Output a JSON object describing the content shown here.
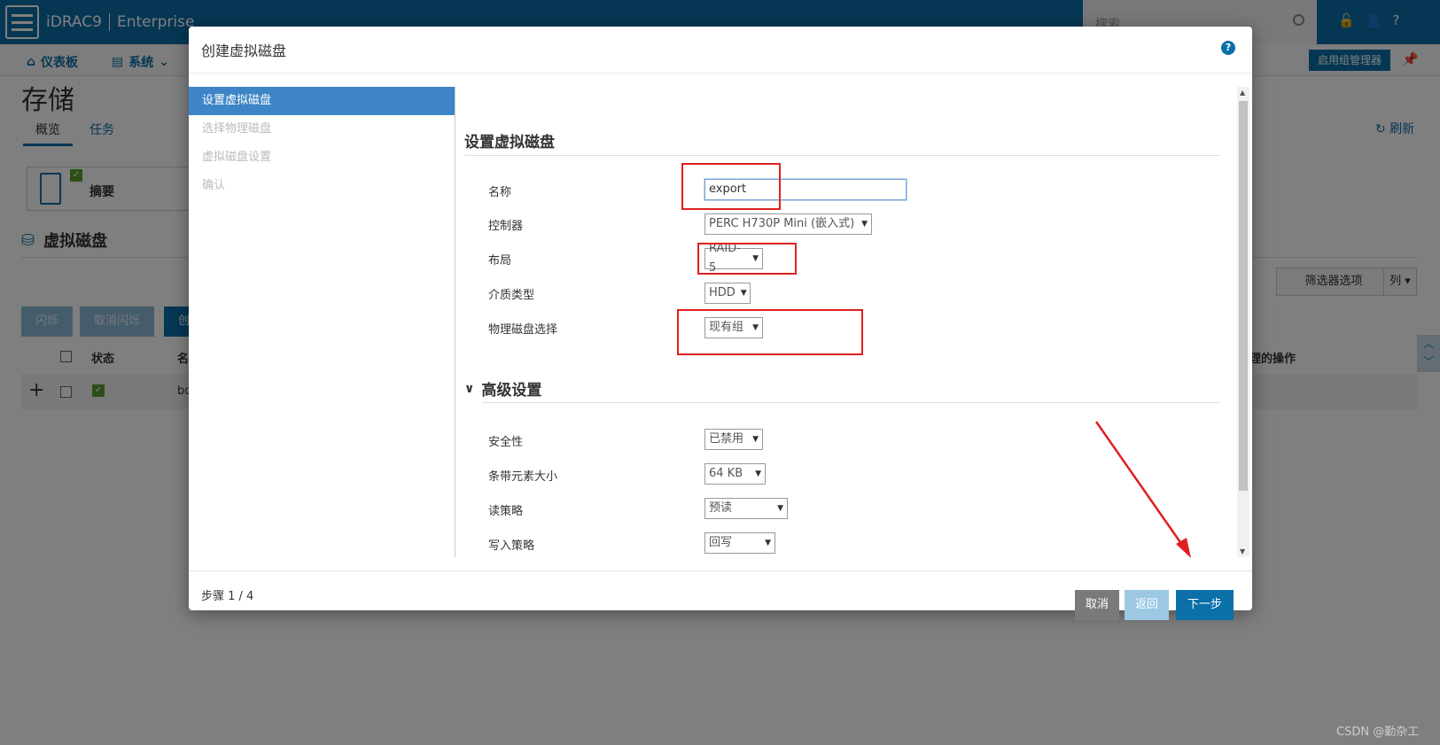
{
  "app": {
    "brand": "iDRAC9",
    "edition": "Enterprise",
    "search_placeholder": "搜索",
    "group_manager": "启用组管理器"
  },
  "nav": {
    "dashboard": "仪表板",
    "system": "系统"
  },
  "page": {
    "title": "存储",
    "tabs": [
      "概览",
      "任务"
    ],
    "refresh": "刷新",
    "summary": "摘要"
  },
  "vdisk": {
    "title": "虚拟磁盘",
    "filter": "筛选器选项",
    "columns_btn": "列",
    "buttons": [
      "闪烁",
      "取消闪烁",
      "创"
    ],
    "headers": {
      "status": "状态",
      "name": "名",
      "actions": "理的操作"
    },
    "row": {
      "name": "bo"
    }
  },
  "modal": {
    "title": "创建虚拟磁盘",
    "steps": [
      "设置虚拟磁盘",
      "选择物理磁盘",
      "虚拟磁盘设置",
      "确认"
    ],
    "section": "设置虚拟磁盘",
    "fields": {
      "name": {
        "label": "名称",
        "value": "export"
      },
      "controller": {
        "label": "控制器",
        "value": "PERC H730P Mini (嵌入式)"
      },
      "layout": {
        "label": "布局",
        "value": "RAID-5"
      },
      "media": {
        "label": "介质类型",
        "value": "HDD"
      },
      "pdisk": {
        "label": "物理磁盘选择",
        "value": "现有组"
      }
    },
    "advanced": {
      "title": "高级设置",
      "security": {
        "label": "安全性",
        "value": "已禁用"
      },
      "stripe": {
        "label": "条带元素大小",
        "value": "64 KB"
      },
      "read": {
        "label": "读策略",
        "value": "预读"
      },
      "write": {
        "label": "写入策略",
        "value": "回写"
      }
    },
    "step_count": "步骤 1 / 4",
    "cancel": "取消",
    "back": "返回",
    "next": "下一步"
  },
  "watermark": "CSDN @勤杂工",
  "colors": {
    "accent": "#0b6fa8",
    "annotation_red": "#e02020"
  }
}
